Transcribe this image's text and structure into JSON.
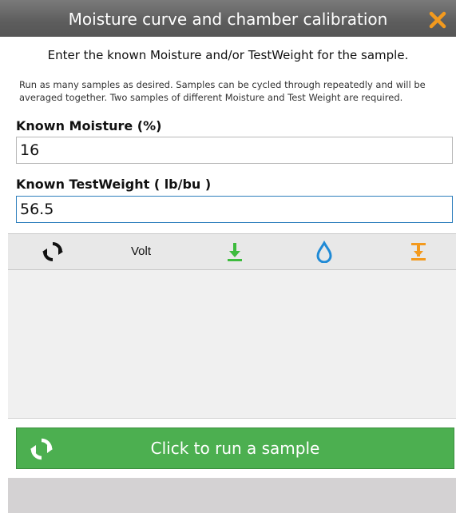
{
  "dialog": {
    "title": "Moisture curve and chamber calibration",
    "close_icon": "close-x-icon",
    "instruction": "Enter the known Moisture and/or TestWeight for the sample.",
    "note": "Run as many samples as desired. Samples can be cycled through repeatedly and will be averaged together. Two samples of different Moisture and Test Weight are required."
  },
  "fields": {
    "moisture_label": "Known Moisture (%)",
    "moisture_value": "16",
    "testweight_label": "Known TestWeight ( lb/bu )",
    "testweight_value": "56.5"
  },
  "toolbar": {
    "items": [
      {
        "icon": "cycle-icon"
      },
      {
        "label": "Volt"
      },
      {
        "icon": "download-icon",
        "color": "#3dbb3d"
      },
      {
        "icon": "water-drop-icon",
        "color": "#1f8ad6"
      },
      {
        "icon": "calibrate-icon",
        "color": "#f39a1e"
      }
    ]
  },
  "run_button": {
    "label": "Click to run a sample",
    "icon": "cycle-icon",
    "color": "#4caf50"
  },
  "colors": {
    "titlebar": "#5d5d5d",
    "accent_orange": "#f39a1e",
    "focus_blue": "#2e7fbd"
  }
}
